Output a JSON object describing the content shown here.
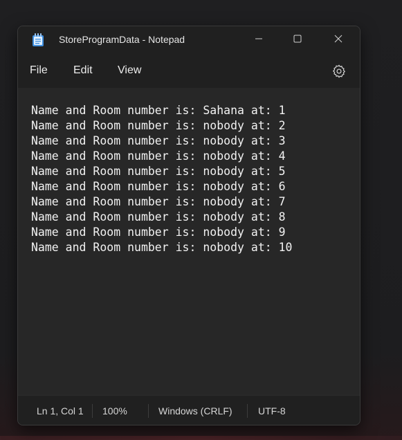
{
  "window": {
    "title": "StoreProgramData - Notepad"
  },
  "menu": {
    "file": "File",
    "edit": "Edit",
    "view": "View"
  },
  "icons": {
    "app": "notepad-icon",
    "minimize": "minimize-icon",
    "maximize": "maximize-icon",
    "close": "close-icon",
    "settings": "gear-icon"
  },
  "editor": {
    "content": "Name and Room number is: Sahana at: 1\nName and Room number is: nobody at: 2\nName and Room number is: nobody at: 3\nName and Room number is: nobody at: 4\nName and Room number is: nobody at: 5\nName and Room number is: nobody at: 6\nName and Room number is: nobody at: 7\nName and Room number is: nobody at: 8\nName and Room number is: nobody at: 9\nName and Room number is: nobody at: 10"
  },
  "status": {
    "position": "Ln 1, Col 1",
    "zoom": "100%",
    "line_endings": "Windows (CRLF)",
    "encoding": "UTF-8"
  },
  "colors": {
    "window_bg": "#202020",
    "editor_bg": "#272727",
    "text": "#f2f2f2",
    "icon_blue": "#3f8fe0"
  }
}
